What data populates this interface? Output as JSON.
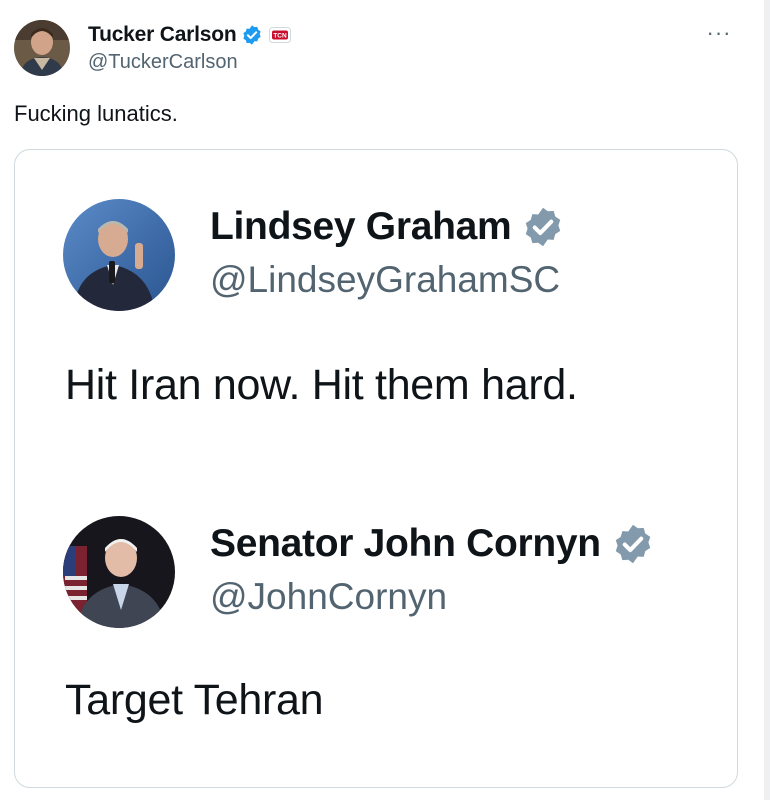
{
  "tweet": {
    "author": {
      "display_name": "Tucker Carlson",
      "handle": "@TuckerCarlson",
      "verified": true,
      "verified_color": "#1d9bf0",
      "affiliation_badge": "TCN"
    },
    "text": "Fucking lunatics.",
    "more_icon": "more-horizontal-icon",
    "more_label": "···"
  },
  "embedded_image": {
    "posts": [
      {
        "display_name": "Lindsey Graham",
        "handle": "@LindseyGrahamSC",
        "verified": true,
        "verified_color": "#829aab",
        "text": "Hit Iran now. Hit them hard."
      },
      {
        "display_name": "Senator John Cornyn",
        "handle": "@JohnCornyn",
        "verified": true,
        "verified_color": "#829aab",
        "text": "Target Tehran"
      }
    ]
  }
}
